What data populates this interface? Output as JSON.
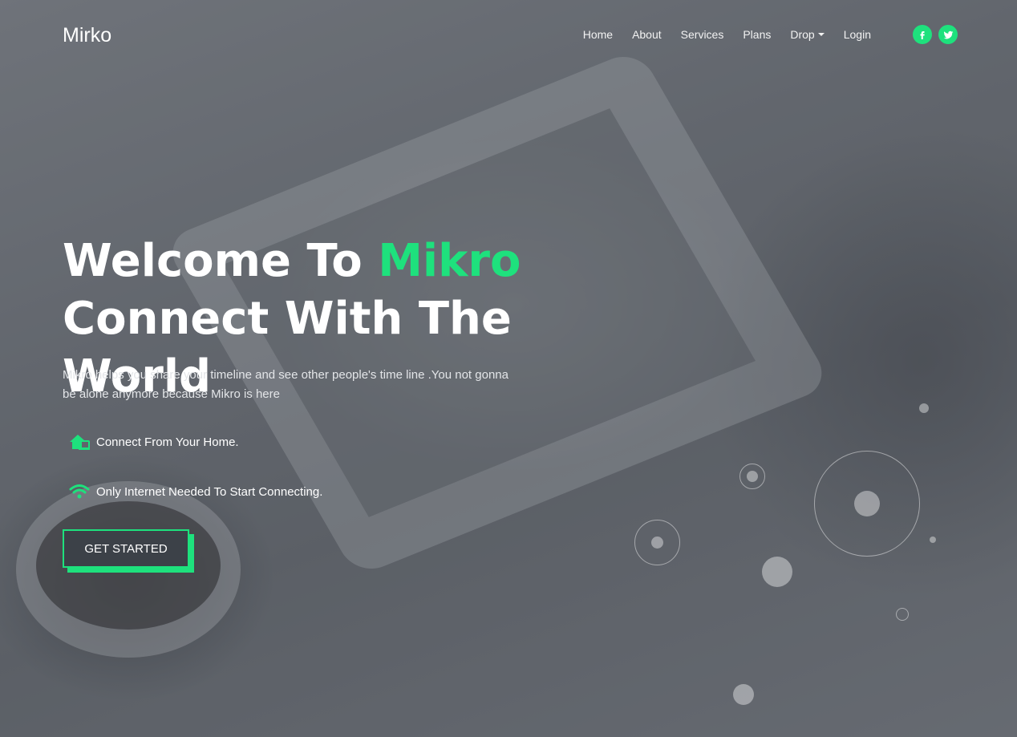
{
  "brand": {
    "name": "Mirko"
  },
  "nav": {
    "items": [
      {
        "label": "Home"
      },
      {
        "label": "About"
      },
      {
        "label": "Services"
      },
      {
        "label": "Plans"
      },
      {
        "label": "Drop",
        "has_dropdown": true
      },
      {
        "label": "Login"
      }
    ],
    "social": [
      {
        "icon": "facebook-icon",
        "glyph": "f"
      },
      {
        "icon": "twitter-icon",
        "glyph": "t"
      }
    ]
  },
  "hero": {
    "title_prefix": "Welcome To ",
    "title_accent": "Mikro",
    "title_line2": "Connect With The World",
    "description": "Mikro helps you share your timeline and see other people's time line .You not gonna be alone anymore because Mikro is here",
    "features": [
      {
        "icon": "home-devices-icon",
        "text": "Connect From Your Home."
      },
      {
        "icon": "wifi-icon",
        "text": "Only Internet Needed To Start Connecting."
      }
    ],
    "cta_label": "GET STARTED"
  },
  "colors": {
    "accent": "#1ee17d",
    "text": "#ffffff",
    "overlay": "#3c4148"
  }
}
